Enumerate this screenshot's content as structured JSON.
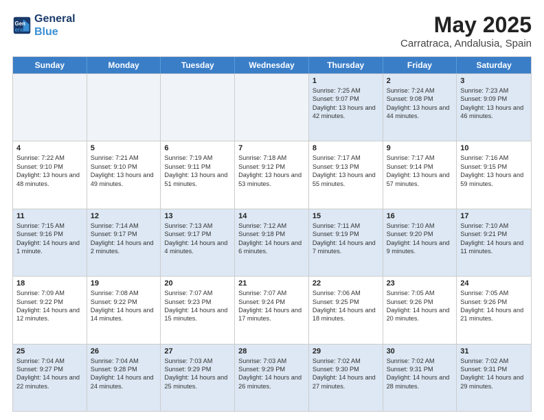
{
  "logo": {
    "line1": "General",
    "line2": "Blue"
  },
  "header": {
    "title": "May 2025",
    "subtitle": "Carratraca, Andalusia, Spain"
  },
  "days": [
    "Sunday",
    "Monday",
    "Tuesday",
    "Wednesday",
    "Thursday",
    "Friday",
    "Saturday"
  ],
  "weeks": [
    [
      {
        "day": "",
        "sunrise": "",
        "sunset": "",
        "daylight": ""
      },
      {
        "day": "",
        "sunrise": "",
        "sunset": "",
        "daylight": ""
      },
      {
        "day": "",
        "sunrise": "",
        "sunset": "",
        "daylight": ""
      },
      {
        "day": "",
        "sunrise": "",
        "sunset": "",
        "daylight": ""
      },
      {
        "day": "1",
        "sunrise": "Sunrise: 7:25 AM",
        "sunset": "Sunset: 9:07 PM",
        "daylight": "Daylight: 13 hours and 42 minutes."
      },
      {
        "day": "2",
        "sunrise": "Sunrise: 7:24 AM",
        "sunset": "Sunset: 9:08 PM",
        "daylight": "Daylight: 13 hours and 44 minutes."
      },
      {
        "day": "3",
        "sunrise": "Sunrise: 7:23 AM",
        "sunset": "Sunset: 9:09 PM",
        "daylight": "Daylight: 13 hours and 46 minutes."
      }
    ],
    [
      {
        "day": "4",
        "sunrise": "Sunrise: 7:22 AM",
        "sunset": "Sunset: 9:10 PM",
        "daylight": "Daylight: 13 hours and 48 minutes."
      },
      {
        "day": "5",
        "sunrise": "Sunrise: 7:21 AM",
        "sunset": "Sunset: 9:10 PM",
        "daylight": "Daylight: 13 hours and 49 minutes."
      },
      {
        "day": "6",
        "sunrise": "Sunrise: 7:19 AM",
        "sunset": "Sunset: 9:11 PM",
        "daylight": "Daylight: 13 hours and 51 minutes."
      },
      {
        "day": "7",
        "sunrise": "Sunrise: 7:18 AM",
        "sunset": "Sunset: 9:12 PM",
        "daylight": "Daylight: 13 hours and 53 minutes."
      },
      {
        "day": "8",
        "sunrise": "Sunrise: 7:17 AM",
        "sunset": "Sunset: 9:13 PM",
        "daylight": "Daylight: 13 hours and 55 minutes."
      },
      {
        "day": "9",
        "sunrise": "Sunrise: 7:17 AM",
        "sunset": "Sunset: 9:14 PM",
        "daylight": "Daylight: 13 hours and 57 minutes."
      },
      {
        "day": "10",
        "sunrise": "Sunrise: 7:16 AM",
        "sunset": "Sunset: 9:15 PM",
        "daylight": "Daylight: 13 hours and 59 minutes."
      }
    ],
    [
      {
        "day": "11",
        "sunrise": "Sunrise: 7:15 AM",
        "sunset": "Sunset: 9:16 PM",
        "daylight": "Daylight: 14 hours and 1 minute."
      },
      {
        "day": "12",
        "sunrise": "Sunrise: 7:14 AM",
        "sunset": "Sunset: 9:17 PM",
        "daylight": "Daylight: 14 hours and 2 minutes."
      },
      {
        "day": "13",
        "sunrise": "Sunrise: 7:13 AM",
        "sunset": "Sunset: 9:17 PM",
        "daylight": "Daylight: 14 hours and 4 minutes."
      },
      {
        "day": "14",
        "sunrise": "Sunrise: 7:12 AM",
        "sunset": "Sunset: 9:18 PM",
        "daylight": "Daylight: 14 hours and 6 minutes."
      },
      {
        "day": "15",
        "sunrise": "Sunrise: 7:11 AM",
        "sunset": "Sunset: 9:19 PM",
        "daylight": "Daylight: 14 hours and 7 minutes."
      },
      {
        "day": "16",
        "sunrise": "Sunrise: 7:10 AM",
        "sunset": "Sunset: 9:20 PM",
        "daylight": "Daylight: 14 hours and 9 minutes."
      },
      {
        "day": "17",
        "sunrise": "Sunrise: 7:10 AM",
        "sunset": "Sunset: 9:21 PM",
        "daylight": "Daylight: 14 hours and 11 minutes."
      }
    ],
    [
      {
        "day": "18",
        "sunrise": "Sunrise: 7:09 AM",
        "sunset": "Sunset: 9:22 PM",
        "daylight": "Daylight: 14 hours and 12 minutes."
      },
      {
        "day": "19",
        "sunrise": "Sunrise: 7:08 AM",
        "sunset": "Sunset: 9:22 PM",
        "daylight": "Daylight: 14 hours and 14 minutes."
      },
      {
        "day": "20",
        "sunrise": "Sunrise: 7:07 AM",
        "sunset": "Sunset: 9:23 PM",
        "daylight": "Daylight: 14 hours and 15 minutes."
      },
      {
        "day": "21",
        "sunrise": "Sunrise: 7:07 AM",
        "sunset": "Sunset: 9:24 PM",
        "daylight": "Daylight: 14 hours and 17 minutes."
      },
      {
        "day": "22",
        "sunrise": "Sunrise: 7:06 AM",
        "sunset": "Sunset: 9:25 PM",
        "daylight": "Daylight: 14 hours and 18 minutes."
      },
      {
        "day": "23",
        "sunrise": "Sunrise: 7:05 AM",
        "sunset": "Sunset: 9:26 PM",
        "daylight": "Daylight: 14 hours and 20 minutes."
      },
      {
        "day": "24",
        "sunrise": "Sunrise: 7:05 AM",
        "sunset": "Sunset: 9:26 PM",
        "daylight": "Daylight: 14 hours and 21 minutes."
      }
    ],
    [
      {
        "day": "25",
        "sunrise": "Sunrise: 7:04 AM",
        "sunset": "Sunset: 9:27 PM",
        "daylight": "Daylight: 14 hours and 22 minutes."
      },
      {
        "day": "26",
        "sunrise": "Sunrise: 7:04 AM",
        "sunset": "Sunset: 9:28 PM",
        "daylight": "Daylight: 14 hours and 24 minutes."
      },
      {
        "day": "27",
        "sunrise": "Sunrise: 7:03 AM",
        "sunset": "Sunset: 9:29 PM",
        "daylight": "Daylight: 14 hours and 25 minutes."
      },
      {
        "day": "28",
        "sunrise": "Sunrise: 7:03 AM",
        "sunset": "Sunset: 9:29 PM",
        "daylight": "Daylight: 14 hours and 26 minutes."
      },
      {
        "day": "29",
        "sunrise": "Sunrise: 7:02 AM",
        "sunset": "Sunset: 9:30 PM",
        "daylight": "Daylight: 14 hours and 27 minutes."
      },
      {
        "day": "30",
        "sunrise": "Sunrise: 7:02 AM",
        "sunset": "Sunset: 9:31 PM",
        "daylight": "Daylight: 14 hours and 28 minutes."
      },
      {
        "day": "31",
        "sunrise": "Sunrise: 7:02 AM",
        "sunset": "Sunset: 9:31 PM",
        "daylight": "Daylight: 14 hours and 29 minutes."
      }
    ]
  ],
  "alt_rows": [
    0,
    2,
    4
  ],
  "colors": {
    "header_bg": "#3a7ec8",
    "alt_row_bg": "#dde8f4",
    "normal_row_bg": "#ffffff"
  }
}
